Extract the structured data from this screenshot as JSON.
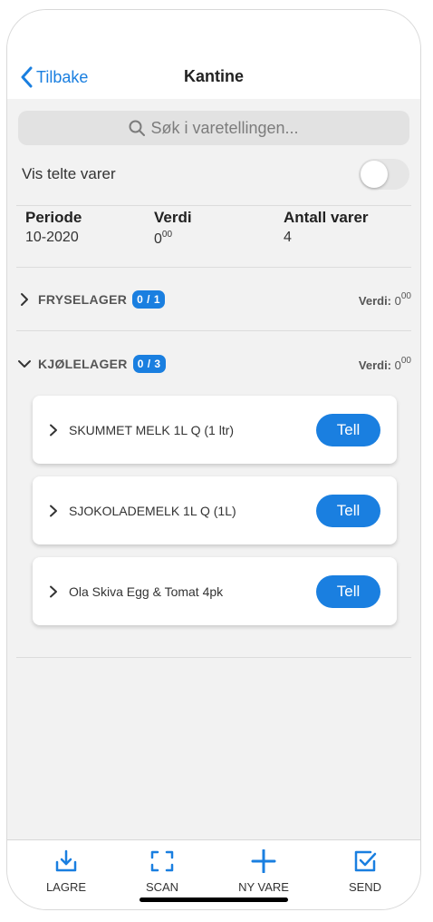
{
  "nav": {
    "back_label": "Tilbake",
    "title": "Kantine"
  },
  "search": {
    "placeholder": "Søk i varetellingen..."
  },
  "toggle": {
    "label": "Vis telte varer",
    "on": false
  },
  "stats": {
    "periode": {
      "label": "Periode",
      "value": "10-2020"
    },
    "verdi": {
      "label": "Verdi",
      "main": "0",
      "sup": "00"
    },
    "antall": {
      "label": "Antall varer",
      "value": "4"
    }
  },
  "sections": [
    {
      "name": "FRYSELAGER",
      "badge": "0 / 1",
      "verdi_label": "Verdi:",
      "verdi_main": "0",
      "verdi_sup": "00",
      "expanded": false
    },
    {
      "name": "KJØLELAGER",
      "badge": "0 / 3",
      "verdi_label": "Verdi:",
      "verdi_main": "0",
      "verdi_sup": "00",
      "expanded": true
    }
  ],
  "items": [
    {
      "name": "SKUMMET MELK 1L Q (1 ltr)",
      "button": "Tell"
    },
    {
      "name": "SJOKOLADEMELK 1L Q (1L)",
      "button": "Tell"
    },
    {
      "name": "Ola Skiva Egg & Tomat 4pk",
      "button": "Tell"
    }
  ],
  "tabs": [
    {
      "label": "LAGRE",
      "icon": "download-tray-icon"
    },
    {
      "label": "SCAN",
      "icon": "scan-frame-icon"
    },
    {
      "label": "NY VARE",
      "icon": "plus-icon"
    },
    {
      "label": "SEND",
      "icon": "checkbox-send-icon"
    }
  ],
  "colors": {
    "accent": "#1a7fe0",
    "background": "#f2f2f2"
  }
}
